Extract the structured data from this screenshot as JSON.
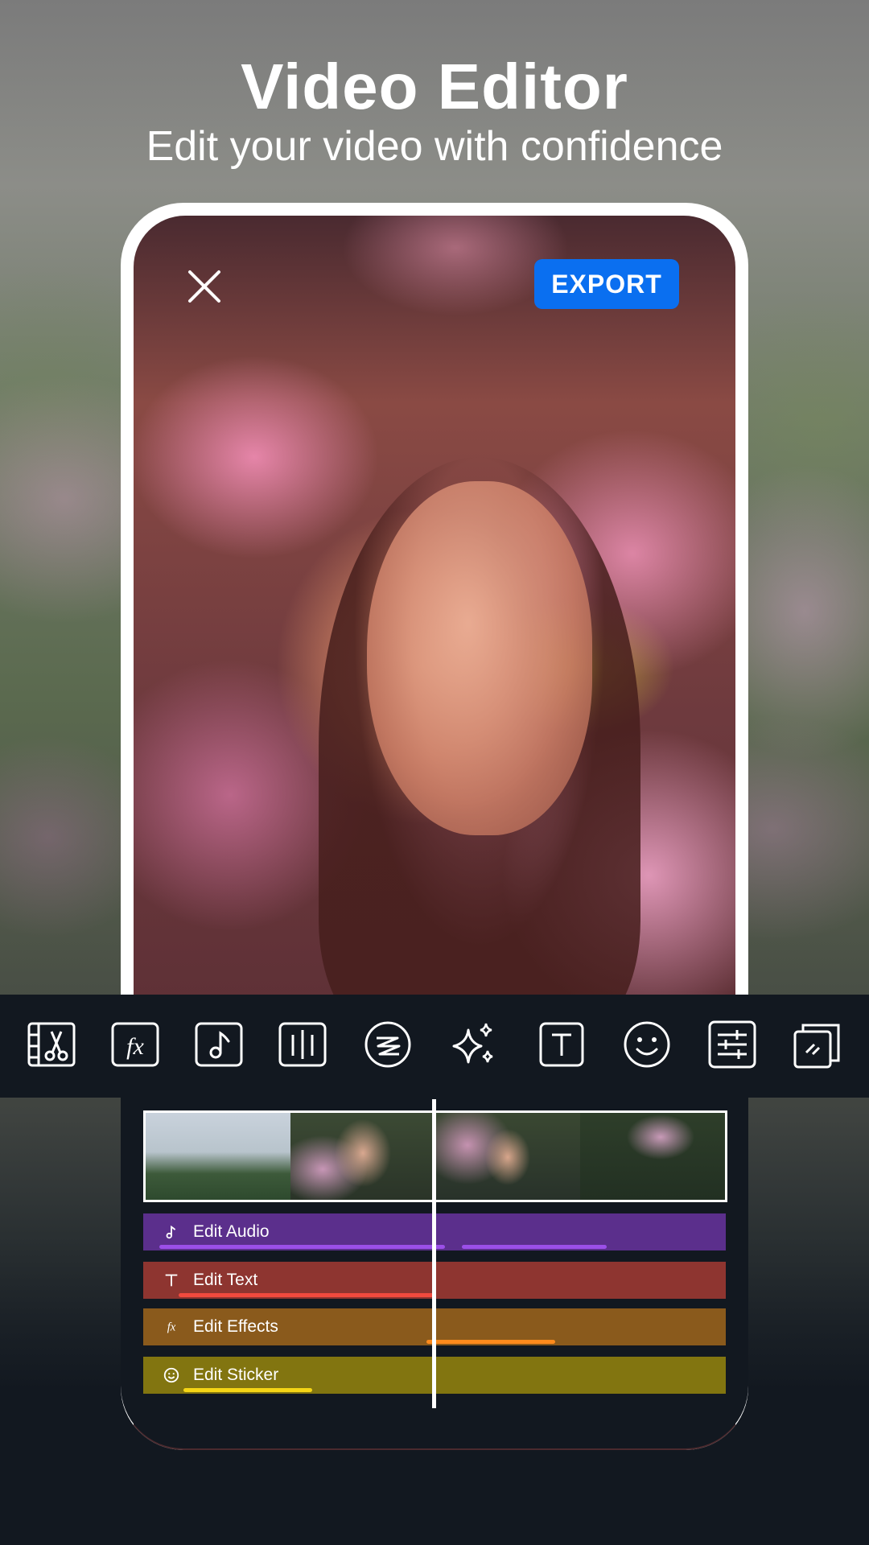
{
  "header": {
    "title": "Video Editor",
    "subtitle": "Edit your video with confidence"
  },
  "editor": {
    "export_label": "EXPORT",
    "accent_color": "#0a6ff0"
  },
  "toolbar": {
    "tools": [
      {
        "icon": "cut-clip-icon"
      },
      {
        "icon": "effects-fx-icon"
      },
      {
        "icon": "music-note-icon"
      },
      {
        "icon": "equalizer-icon"
      },
      {
        "icon": "speed-icon"
      },
      {
        "icon": "sparkle-icon"
      },
      {
        "icon": "text-icon"
      },
      {
        "icon": "smiley-icon"
      },
      {
        "icon": "adjust-sliders-icon"
      },
      {
        "icon": "layers-icon"
      }
    ]
  },
  "timeline": {
    "tracks": [
      {
        "label": "Edit Audio",
        "icon": "music-note-icon",
        "color": "#5b2f8c",
        "bar_color": "#9b4fe8"
      },
      {
        "label": "Edit Text",
        "icon": "text-icon",
        "color": "#8e3530",
        "bar_color": "#f04a3e"
      },
      {
        "label": "Edit Effects",
        "icon": "effects-fx-icon",
        "color": "#8a5a1c",
        "bar_color": "#ff8a1c"
      },
      {
        "label": "Edit Sticker",
        "icon": "smiley-icon",
        "color": "#827510",
        "bar_color": "#f5d516"
      }
    ]
  }
}
